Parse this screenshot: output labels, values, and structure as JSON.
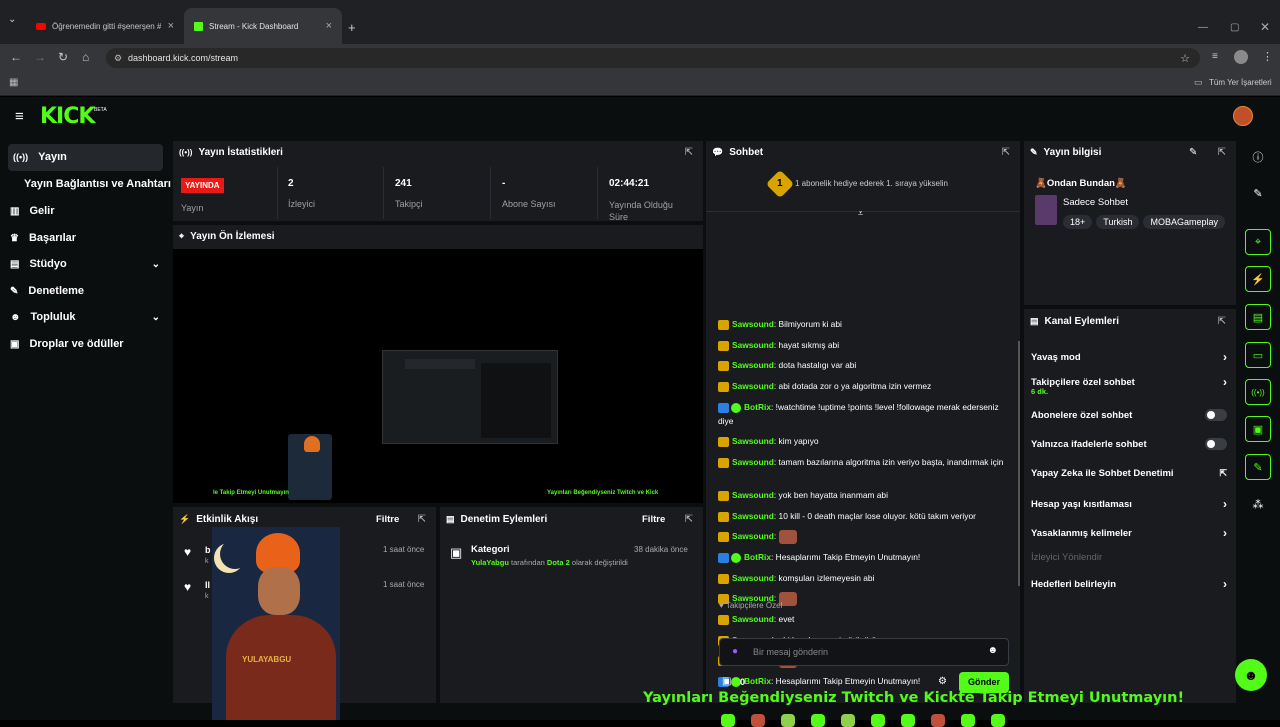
{
  "browser": {
    "tabs": [
      {
        "label": "Öğrenemedin gitti #şenerşen #"
      },
      {
        "label": "Stream - Kick Dashboard"
      }
    ],
    "url": "dashboard.kick.com/stream",
    "bookmarks_label": "Tüm Yer İşaretleri"
  },
  "app": {
    "logo": "KICK",
    "logo_beta": "BETA"
  },
  "sidebar": {
    "items": [
      {
        "label": "Yayın",
        "icon": "broadcast-icon"
      },
      {
        "label": "Yayın Bağlantısı ve Anahtarı"
      },
      {
        "label": "Gelir",
        "icon": "chart-icon"
      },
      {
        "label": "Başarılar",
        "icon": "trophy-icon"
      },
      {
        "label": "Stüdyo",
        "icon": "studio-icon"
      },
      {
        "label": "Denetleme",
        "icon": "wrench-icon"
      },
      {
        "label": "Topluluk",
        "icon": "people-icon"
      },
      {
        "label": "Droplar ve ödüller",
        "icon": "gift-icon"
      }
    ]
  },
  "stats": {
    "title": "Yayın İstatistikleri",
    "live_badge": "YAYINDA",
    "live_label": "Yayın",
    "viewers_value": "2",
    "viewers_label": "İzleyici",
    "followers_value": "241",
    "followers_label": "Takipçi",
    "subs_value": "-",
    "subs_label": "Abone Sayısı",
    "duration_value": "02:44:21",
    "duration_label": "Yayında Olduğu Süre"
  },
  "preview": {
    "title": "Yayın Ön İzlemesi",
    "left_caption": "le Takip Etmeyi Unutmayın",
    "right_caption": "Yayınları Beğendiyseniz Twitch ve Kick"
  },
  "activity": {
    "title": "Etkinlik Akışı",
    "filter": "Filtre",
    "items": [
      {
        "name": "b",
        "sub": "k",
        "time": "1 saat önce"
      },
      {
        "name": "Il",
        "sub": "k",
        "time": "1 saat önce"
      }
    ]
  },
  "moderation": {
    "title": "Denetim Eylemleri",
    "filter": "Filtre",
    "item_title": "Kategori",
    "item_time": "38 dakika önce",
    "item_user": "YulaYabgu",
    "item_mid": "tarafından",
    "item_cat": "Dota 2",
    "item_end": "olarak değiştirildi"
  },
  "chat": {
    "title": "Sohbet",
    "gift_rank": "1",
    "gift_text": "1 abonelik hediye ederek 1. sıraya yükselin",
    "messages": [
      {
        "user": "Sawsound",
        "text": "Bilmiyorum ki abi",
        "badge": "crown"
      },
      {
        "user": "Sawsound",
        "text": "hayat sıkmış abi",
        "badge": "crown"
      },
      {
        "user": "Sawsound",
        "text": "dota hastalıgı var abi",
        "badge": "crown"
      },
      {
        "user": "Sawsound",
        "text": "abi dotada zor o ya algoritma izin vermez",
        "badge": "crown"
      },
      {
        "user": "BotRix",
        "text": "!watchtime !uptime !points !level !followage merak ederseniz diye",
        "badge": "bot"
      },
      {
        "user": "Sawsound",
        "text": "kim yapıyo",
        "badge": "crown"
      },
      {
        "user": "Sawsound",
        "text": "tamam bazılarına algoritma izin veriyo başta, inandırmak için",
        "badge": "crown"
      },
      {
        "user": "Sawsound",
        "text": "yok ben hayatta inanmam abi",
        "badge": "crown"
      },
      {
        "user": "Sawsound",
        "text": "10 kill - 0 death maçlar lose oluyor. kötü takım veriyor",
        "badge": "crown"
      },
      {
        "user": "Sawsound",
        "text": "",
        "badge": "crown",
        "emote": true
      },
      {
        "user": "BotRix",
        "text": "Hesaplarımı Takip Etmeyin Unutmayın!",
        "badge": "bot"
      },
      {
        "user": "Sawsound",
        "text": "komşuları izlemeyesin abi",
        "badge": "crown"
      },
      {
        "user": "Sawsound",
        "text": "",
        "badge": "crown",
        "emote": true
      },
      {
        "user": "Sawsound",
        "text": "evet",
        "badge": "crown"
      },
      {
        "user": "Sawsound",
        "text": "abi ben kaççanzi görüşürüz",
        "badge": "crown"
      },
      {
        "user": "Sawsound",
        "text": "",
        "badge": "crown",
        "emote": true
      },
      {
        "user": "BotRix",
        "text": "Hesaplarımı Takip Etmeyin Unutmayın!",
        "badge": "bot"
      }
    ],
    "emote_section": "Takipçilere Özel",
    "input_placeholder": "Bir mesaj gönderin",
    "points": "0",
    "send": "Gönder"
  },
  "stream_info": {
    "title": "Yayın bilgisi",
    "stream_title": "🧸Ondan Bundan🧸",
    "category": "Sadece Sohbet",
    "tags": [
      "18+",
      "Turkish",
      "MOBAGameplay"
    ]
  },
  "channel_actions": {
    "title": "Kanal Eylemleri",
    "items": [
      {
        "label": "Yavaş mod",
        "kind": "chevron"
      },
      {
        "label": "Takipçilere özel sohbet",
        "sub": "6 dk.",
        "kind": "chevron"
      },
      {
        "label": "Abonelere özel sohbet",
        "kind": "toggle"
      },
      {
        "label": "Yalnızca ifadelerle sohbet",
        "kind": "toggle"
      },
      {
        "label": "Yapay Zeka ile Sohbet Denetimi",
        "kind": "external"
      },
      {
        "label": "Hesap yaşı kısıtlaması",
        "kind": "chevron"
      },
      {
        "label": "Yasaklanmış kelimeler",
        "kind": "chevron"
      },
      {
        "label": "İzleyici Yönlendir",
        "kind": "disabled"
      },
      {
        "label": "Hedefleri belirleyin",
        "kind": "chevron"
      }
    ]
  },
  "overlay": {
    "banner": "Yayınları Beğendiyseniz Twitch ve Kickte Takip Etmeyi Unutmayın!",
    "avatar_text": "YULAYABGU"
  },
  "colors": {
    "accent": "#53fc18",
    "panel": "#191b1f",
    "bg": "#0b0e0f",
    "live": "#e91916"
  }
}
